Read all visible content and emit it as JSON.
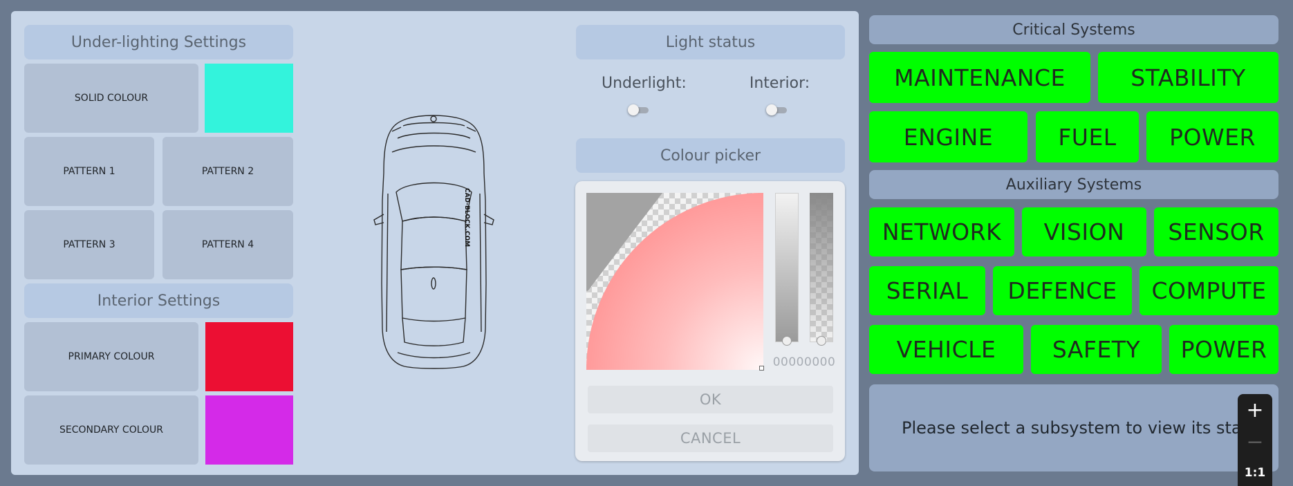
{
  "under_lighting": {
    "title": "Under-lighting Settings",
    "solid_colour_label": "SOLID COLOUR",
    "solid_colour": "#33f3dc",
    "patterns": [
      "PATTERN 1",
      "PATTERN 2",
      "PATTERN 3",
      "PATTERN 4"
    ]
  },
  "interior": {
    "title": "Interior Settings",
    "primary_label": "PRIMARY COLOUR",
    "primary_colour": "#ec0f33",
    "secondary_label": "SECONDARY COLOUR",
    "secondary_colour": "#d42ae8"
  },
  "car": {
    "watermark": "CAD-BLOCK.COM"
  },
  "light_status": {
    "title": "Light status",
    "underlight_label": "Underlight:",
    "underlight_on": false,
    "interior_label": "Interior:",
    "interior_on": false
  },
  "colour_picker": {
    "title": "Colour picker",
    "hex_value": "00000000",
    "ok_label": "OK",
    "cancel_label": "CANCEL"
  },
  "critical": {
    "title": "Critical Systems",
    "buttons": [
      "MAINTENANCE",
      "STABILITY",
      "ENGINE",
      "FUEL",
      "POWER"
    ]
  },
  "auxiliary": {
    "title": "Auxiliary Systems",
    "buttons": [
      "NETWORK",
      "VISION",
      "SENSOR",
      "SERIAL",
      "DEFENCE",
      "COMPUTE",
      "VEHICLE",
      "SAFETY",
      "POWER"
    ]
  },
  "status_message": "Please select a subsystem to view its status",
  "zoom": {
    "zoom_in": "+",
    "zoom_out": "−",
    "reset": "1:1"
  },
  "colors": {
    "page_bg": "#6b7a8f",
    "panel_bg": "#c8d6e8",
    "system_button": "#00ff00",
    "system_header": "#94a7c3"
  }
}
